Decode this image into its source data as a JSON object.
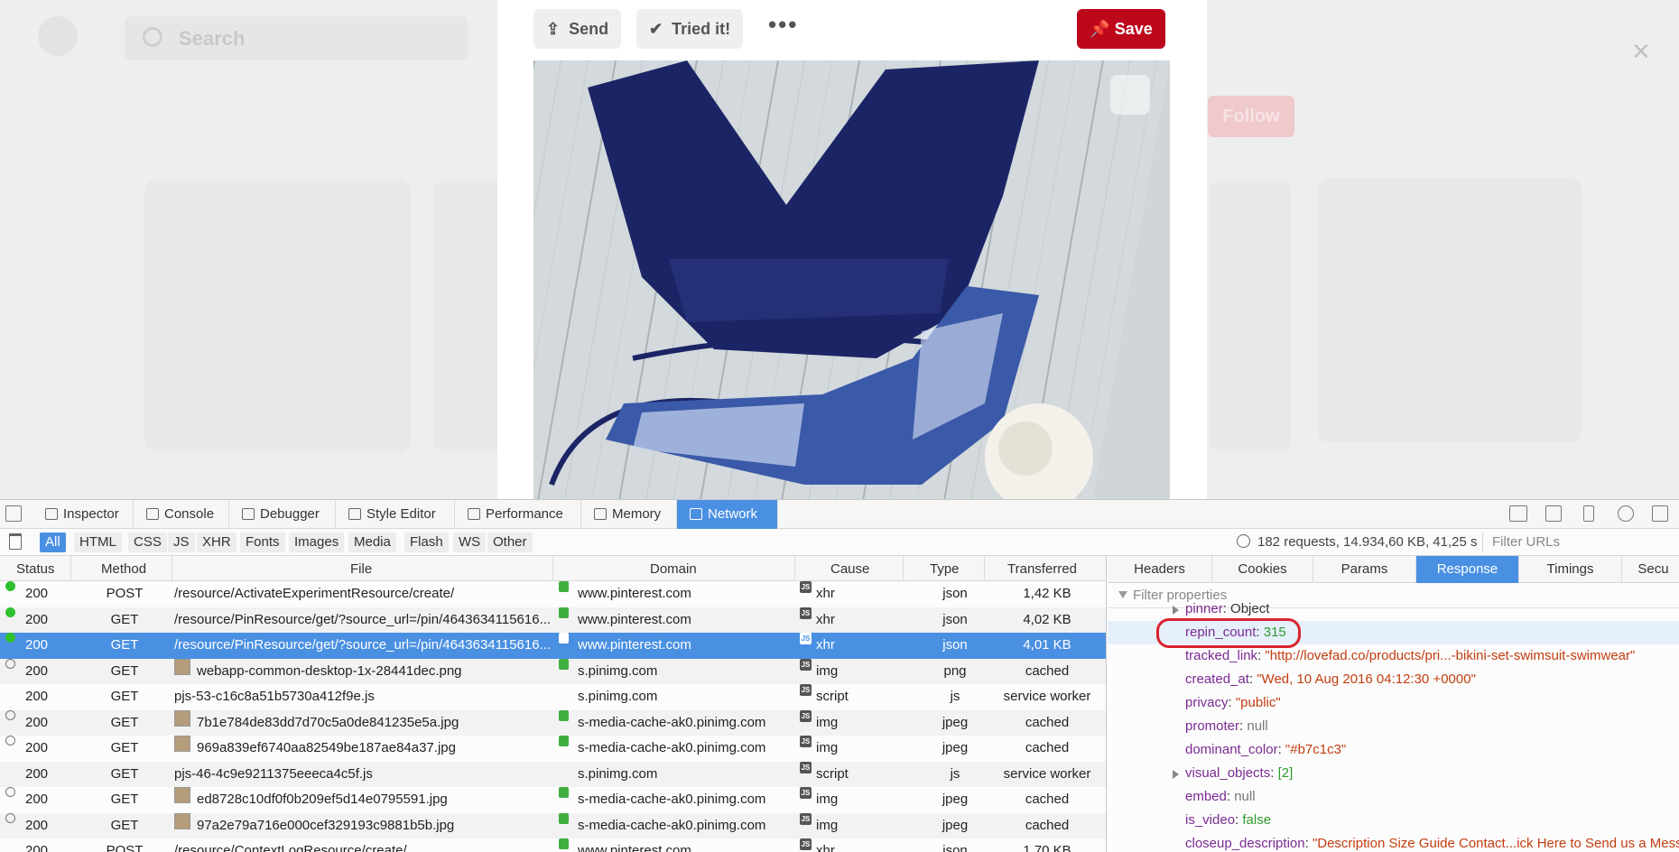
{
  "background": {
    "search_placeholder": "Search",
    "follow_label": "Follow",
    "close_glyph": "×"
  },
  "pin": {
    "send_label": "Send",
    "tried_label": "Tried it!",
    "more_glyph": "•••",
    "save_label": "Save",
    "icons": {
      "send": "share-icon",
      "tried": "check-icon",
      "save": "pin-icon",
      "lens": "visual-search-icon"
    }
  },
  "devtools": {
    "tabs": [
      {
        "label": "Inspector"
      },
      {
        "label": "Console"
      },
      {
        "label": "Debugger"
      },
      {
        "label": "Style Editor"
      },
      {
        "label": "Performance"
      },
      {
        "label": "Memory"
      },
      {
        "label": "Network",
        "active": true
      }
    ],
    "filters": [
      "All",
      "HTML",
      "CSS",
      "JS",
      "XHR",
      "Fonts",
      "Images",
      "Media",
      "Flash",
      "WS",
      "Other"
    ],
    "active_filter": "All",
    "summary": "182 requests, 14.934,60 KB, 41,25 s",
    "filter_urls_placeholder": "Filter URLs",
    "columns": [
      "Status",
      "Method",
      "File",
      "Domain",
      "Cause",
      "Type",
      "Transferred"
    ],
    "requests": [
      {
        "status": "200",
        "method": "POST",
        "file": "/resource/ActivateExperimentResource/create/",
        "domain": "www.pinterest.com",
        "cause": "xhr",
        "type": "json",
        "transferred": "1,42 KB",
        "indicator": "green",
        "secure": true
      },
      {
        "status": "200",
        "method": "GET",
        "file": "/resource/PinResource/get/?source_url=/pin/4643634115616...",
        "domain": "www.pinterest.com",
        "cause": "xhr",
        "type": "json",
        "transferred": "4,02 KB",
        "indicator": "green",
        "secure": true
      },
      {
        "status": "200",
        "method": "GET",
        "file": "/resource/PinResource/get/?source_url=/pin/4643634115616...",
        "domain": "www.pinterest.com",
        "cause": "xhr",
        "type": "json",
        "transferred": "4,01 KB",
        "indicator": "green",
        "secure": true,
        "selected": true
      },
      {
        "status": "200",
        "method": "GET",
        "file": "webapp-common-desktop-1x-28441dec.png",
        "domain": "s.pinimg.com",
        "cause": "img",
        "type": "png",
        "transferred": "cached",
        "indicator": "empty",
        "secure": true,
        "thumb": true
      },
      {
        "status": "200",
        "method": "GET",
        "file": "pjs-53-c16c8a51b5730a412f9e.js",
        "domain": "s.pinimg.com",
        "cause": "script",
        "type": "js",
        "transferred": "service worker",
        "indicator": "none",
        "secure": false
      },
      {
        "status": "200",
        "method": "GET",
        "file": "7b1e784de83dd7d70c5a0de841235e5a.jpg",
        "domain": "s-media-cache-ak0.pinimg.com",
        "cause": "img",
        "type": "jpeg",
        "transferred": "cached",
        "indicator": "empty",
        "secure": true,
        "thumb": true
      },
      {
        "status": "200",
        "method": "GET",
        "file": "969a839ef6740aa82549be187ae84a37.jpg",
        "domain": "s-media-cache-ak0.pinimg.com",
        "cause": "img",
        "type": "jpeg",
        "transferred": "cached",
        "indicator": "empty",
        "secure": true,
        "thumb": true
      },
      {
        "status": "200",
        "method": "GET",
        "file": "pjs-46-4c9e9211375eeeca4c5f.js",
        "domain": "s.pinimg.com",
        "cause": "script",
        "type": "js",
        "transferred": "service worker",
        "indicator": "none",
        "secure": false
      },
      {
        "status": "200",
        "method": "GET",
        "file": "ed8728c10df0f0b209ef5d14e0795591.jpg",
        "domain": "s-media-cache-ak0.pinimg.com",
        "cause": "img",
        "type": "jpeg",
        "transferred": "cached",
        "indicator": "empty",
        "secure": true,
        "thumb": true
      },
      {
        "status": "200",
        "method": "GET",
        "file": "97a2e79a716e000cef329193c9881b5b.jpg",
        "domain": "s-media-cache-ak0.pinimg.com",
        "cause": "img",
        "type": "jpeg",
        "transferred": "cached",
        "indicator": "empty",
        "secure": true,
        "thumb": true
      },
      {
        "status": "200",
        "method": "POST",
        "file": "/resource/ContextLogResource/create/",
        "domain": "www.pinterest.com",
        "cause": "xhr",
        "type": "json",
        "transferred": "1,70 KB",
        "indicator": "none",
        "secure": true
      }
    ],
    "detail_tabs": [
      "Headers",
      "Cookies",
      "Params",
      "Response",
      "Timings",
      "Secu"
    ],
    "active_detail_tab": "Response",
    "filter_properties_placeholder": "Filter properties",
    "properties": [
      {
        "key": "pinner",
        "value": "Object",
        "kind": "obj",
        "expandable": true
      },
      {
        "key": "repin_count",
        "value": "315",
        "kind": "num",
        "highlight": true
      },
      {
        "key": "tracked_link",
        "value": "\"http://lovefad.co/products/pri...-bikini-set-swimsuit-swimwear\"",
        "kind": "str"
      },
      {
        "key": "created_at",
        "value": "\"Wed, 10 Aug 2016 04:12:30 +0000\"",
        "kind": "str"
      },
      {
        "key": "privacy",
        "value": "\"public\"",
        "kind": "str"
      },
      {
        "key": "promoter",
        "value": "null",
        "kind": "null"
      },
      {
        "key": "dominant_color",
        "value": "\"#b7c1c3\"",
        "kind": "str"
      },
      {
        "key": "visual_objects",
        "value": "[2]",
        "kind": "num",
        "expandable": true
      },
      {
        "key": "embed",
        "value": "null",
        "kind": "null"
      },
      {
        "key": "is_video",
        "value": "false",
        "kind": "bool"
      },
      {
        "key": "closeup_description",
        "value": "\"Description Size Guide Contact...ick Here to Send us a Messa",
        "kind": "str"
      }
    ]
  },
  "colors": {
    "save_red": "#bd081c",
    "devtools_accent": "#4a90e2",
    "annotation_red": "#d9232f"
  }
}
